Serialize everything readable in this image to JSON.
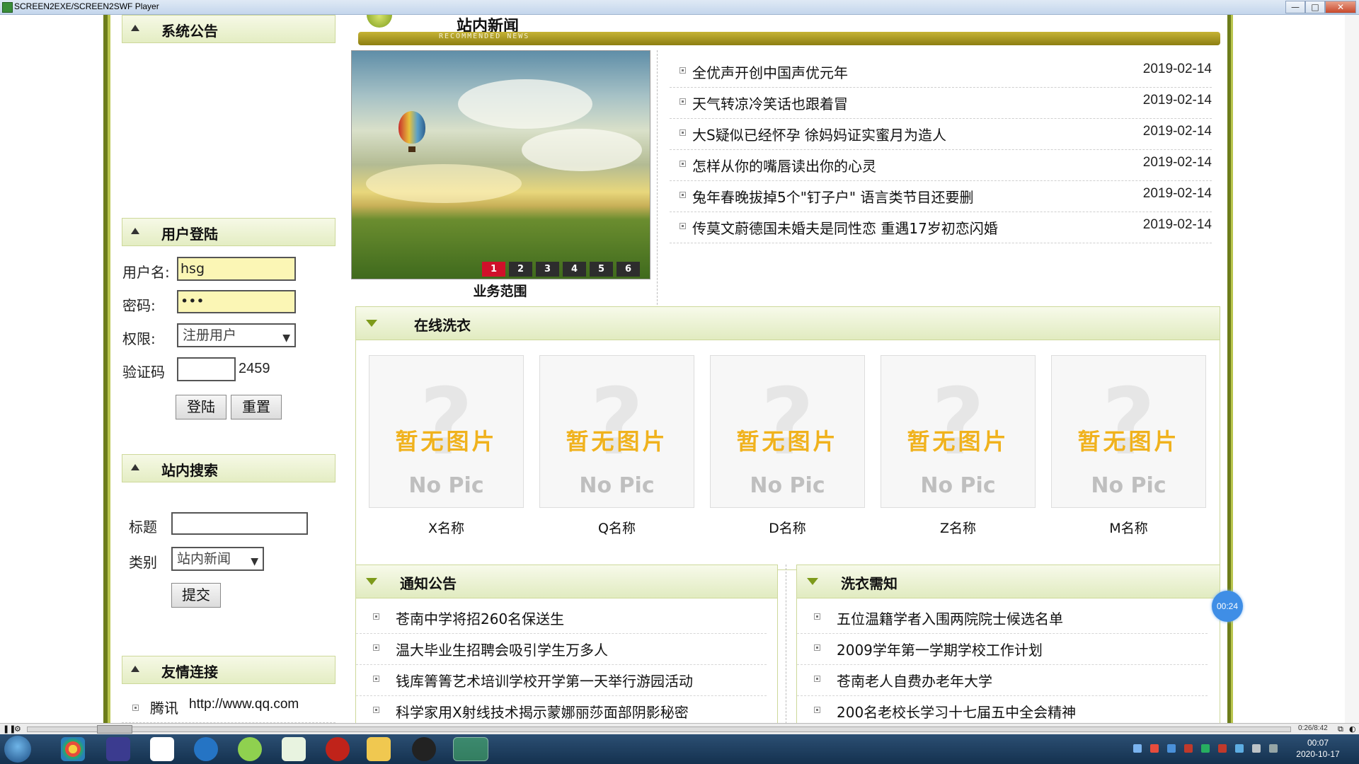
{
  "window": {
    "title": "SCREEN2EXE/SCREEN2SWF Player",
    "minimize": "—",
    "maximize": "□",
    "close": "✕"
  },
  "sidebar": {
    "announcement": {
      "title": "系统公告"
    },
    "login": {
      "title": "用户登陆",
      "username_label": "用户名:",
      "username_value": "hsg",
      "password_label": "密码:",
      "password_value": "•••",
      "role_label": "权限:",
      "role_value": "注册用户",
      "captcha_label": "验证码",
      "captcha_value": "",
      "captcha_code": "2459",
      "login_button": "登陆",
      "reset_button": "重置"
    },
    "search": {
      "title": "站内搜索",
      "title_label": "标题",
      "title_value": "",
      "category_label": "类别",
      "category_value": "站内新闻",
      "submit_button": "提交"
    },
    "links": {
      "title": "友情连接",
      "items": [
        {
          "name": "腾讯",
          "url": "http://www.qq.com"
        }
      ]
    }
  },
  "news": {
    "title": "站内新闻",
    "subtitle": "RECOMMENDED NEWS",
    "slideshow_caption": "业务范围",
    "slide_numbers": [
      "1",
      "2",
      "3",
      "4",
      "5",
      "6"
    ],
    "active_slide": 1,
    "items": [
      {
        "title": "全优声开创中国声优元年",
        "date": "2019-02-14"
      },
      {
        "title": "天气转凉冷笑话也跟着冒",
        "date": "2019-02-14"
      },
      {
        "title": "大S疑似已经怀孕 徐妈妈证实蜜月为造人",
        "date": "2019-02-14"
      },
      {
        "title": "怎样从你的嘴唇读出你的心灵",
        "date": "2019-02-14"
      },
      {
        "title": "兔年春晚拔掉5个\"钉子户\" 语言类节目还要删",
        "date": "2019-02-14"
      },
      {
        "title": "传莫文蔚德国未婚夫是同性恋 重遇17岁初恋闪婚",
        "date": "2019-02-14"
      }
    ]
  },
  "laundry": {
    "title": "在线洗衣",
    "placeholder_cn": "暂无图片",
    "placeholder_en": "No Pic",
    "placeholder_mark": "?",
    "items": [
      {
        "name": "X名称"
      },
      {
        "name": "Q名称"
      },
      {
        "name": "D名称"
      },
      {
        "name": "Z名称"
      },
      {
        "name": "M名称"
      }
    ]
  },
  "notices": {
    "title": "通知公告",
    "items": [
      "苍南中学将招260名保送生",
      "温大毕业生招聘会吸引学生万多人",
      "钱库箐箐艺术培训学校开学第一天举行游园活动",
      "科学家用X射线技术揭示蒙娜丽莎面部阴影秘密"
    ]
  },
  "laundry_notes": {
    "title": "洗衣需知",
    "items": [
      "五位温籍学者入围两院院士候选名单",
      "2009学年第一学期学校工作计划",
      "苍南老人自费办老年大学",
      "200名老校长学习十七届五中全会精神"
    ]
  },
  "recording_timer": "00:24",
  "player": {
    "time": "0:26/8:42"
  },
  "taskbar": {
    "time": "00:07",
    "date": "2020-10-17"
  },
  "colors": {
    "accent_dark": "#6d7d1b",
    "accent_light": "#b9c54e",
    "header_bar": "#a89a23",
    "active_dot": "#d0102a"
  }
}
